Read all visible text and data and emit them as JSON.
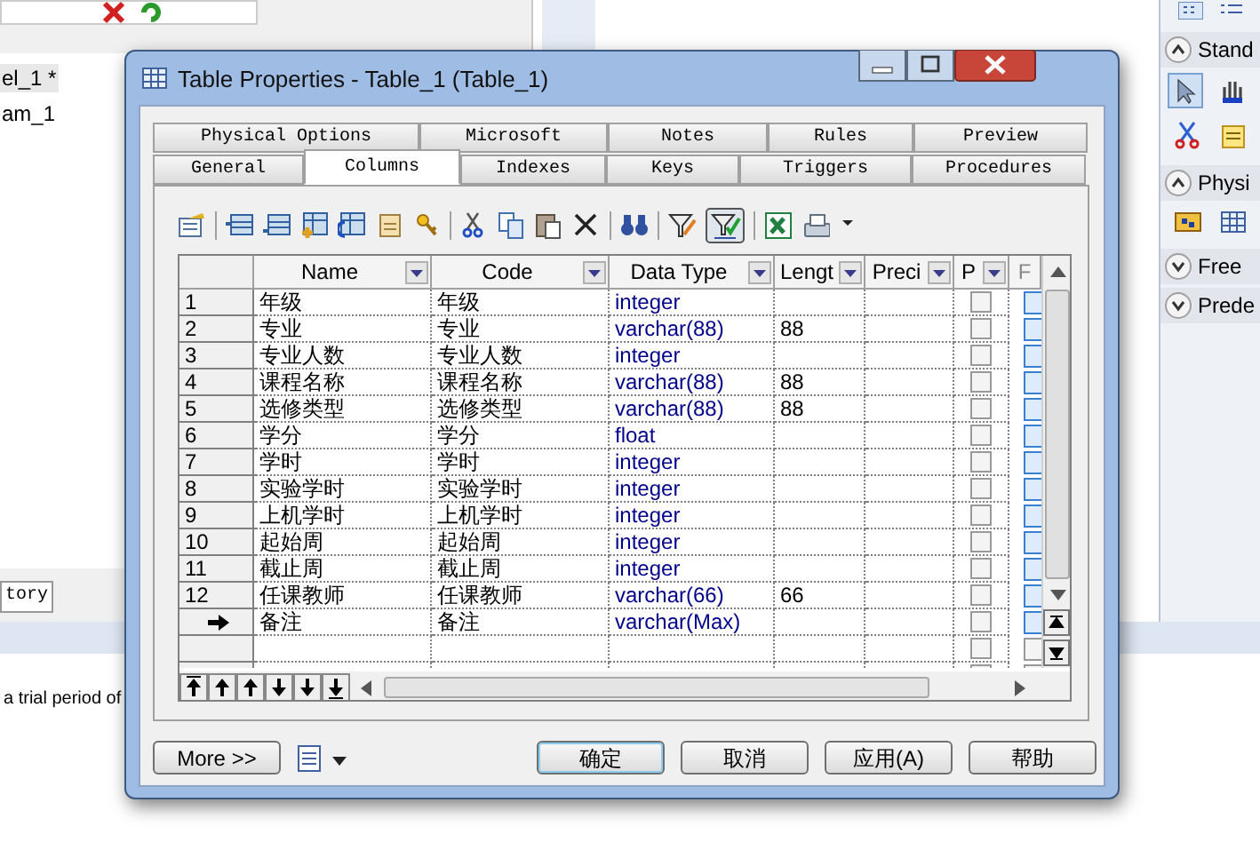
{
  "background": {
    "tree_items": [
      "el_1 *",
      "am_1"
    ],
    "tab": "tory",
    "message": "a trial period of"
  },
  "toolbox": {
    "sections": [
      {
        "label": "Stand",
        "expanded": true
      },
      {
        "label": "Physi",
        "expanded": true
      },
      {
        "label": "Free",
        "expanded": false
      },
      {
        "label": "Prede",
        "expanded": false
      }
    ]
  },
  "dialog": {
    "title": "Table Properties - Table_1 (Table_1)",
    "tab_rows": [
      [
        {
          "label": "Physical Options",
          "selected": false
        },
        {
          "label": "Microsoft",
          "selected": false
        },
        {
          "label": "Notes",
          "selected": false
        },
        {
          "label": "Rules",
          "selected": false
        },
        {
          "label": "Preview",
          "selected": false
        }
      ],
      [
        {
          "label": "General",
          "selected": false
        },
        {
          "label": "Columns",
          "selected": true
        },
        {
          "label": "Indexes",
          "selected": false
        },
        {
          "label": "Keys",
          "selected": false
        },
        {
          "label": "Triggers",
          "selected": false
        },
        {
          "label": "Procedures",
          "selected": false
        }
      ]
    ],
    "filter_pressed": true,
    "columns": [
      "Name",
      "Code",
      "Data Type",
      "Lengt",
      "Preci",
      "P",
      "F"
    ],
    "rows": [
      {
        "number": "1",
        "name": "年级",
        "code": "年级",
        "data_type": "integer",
        "length": "",
        "current": false,
        "primary": false,
        "f": true
      },
      {
        "number": "2",
        "name": "专业",
        "code": "专业",
        "data_type": "varchar(88)",
        "length": "88",
        "current": false,
        "primary": false,
        "f": true
      },
      {
        "number": "3",
        "name": "专业人数",
        "code": "专业人数",
        "data_type": "integer",
        "length": "",
        "current": false,
        "primary": false,
        "f": true
      },
      {
        "number": "4",
        "name": "课程名称",
        "code": "课程名称",
        "data_type": "varchar(88)",
        "length": "88",
        "current": false,
        "primary": false,
        "f": true
      },
      {
        "number": "5",
        "name": "选修类型",
        "code": "选修类型",
        "data_type": "varchar(88)",
        "length": "88",
        "current": false,
        "primary": false,
        "f": true
      },
      {
        "number": "6",
        "name": "学分",
        "code": "学分",
        "data_type": "float",
        "length": "",
        "current": false,
        "primary": false,
        "f": true
      },
      {
        "number": "7",
        "name": "学时",
        "code": "学时",
        "data_type": "integer",
        "length": "",
        "current": false,
        "primary": false,
        "f": true
      },
      {
        "number": "8",
        "name": "实验学时",
        "code": "实验学时",
        "data_type": "integer",
        "length": "",
        "current": false,
        "primary": false,
        "f": true
      },
      {
        "number": "9",
        "name": "上机学时",
        "code": "上机学时",
        "data_type": "integer",
        "length": "",
        "current": false,
        "primary": false,
        "f": true
      },
      {
        "number": "10",
        "name": "起始周",
        "code": "起始周",
        "data_type": "integer",
        "length": "",
        "current": false,
        "primary": false,
        "f": true
      },
      {
        "number": "11",
        "name": "截止周",
        "code": "截止周",
        "data_type": "integer",
        "length": "",
        "current": false,
        "primary": false,
        "f": true
      },
      {
        "number": "12",
        "name": "任课教师",
        "code": "任课教师",
        "data_type": "varchar(66)",
        "length": "66",
        "current": false,
        "primary": false,
        "f": true
      },
      {
        "name": "备注",
        "code": "备注",
        "data_type": "varchar(Max)",
        "current": true,
        "primary": false,
        "f": true
      }
    ],
    "empty_rows": [
      {
        "primary": false,
        "f": false
      },
      {
        "primary": false,
        "f": false
      }
    ],
    "more_button": "More >>",
    "buttons": [
      "确定",
      "取消",
      "应用(A)",
      "帮助"
    ]
  }
}
